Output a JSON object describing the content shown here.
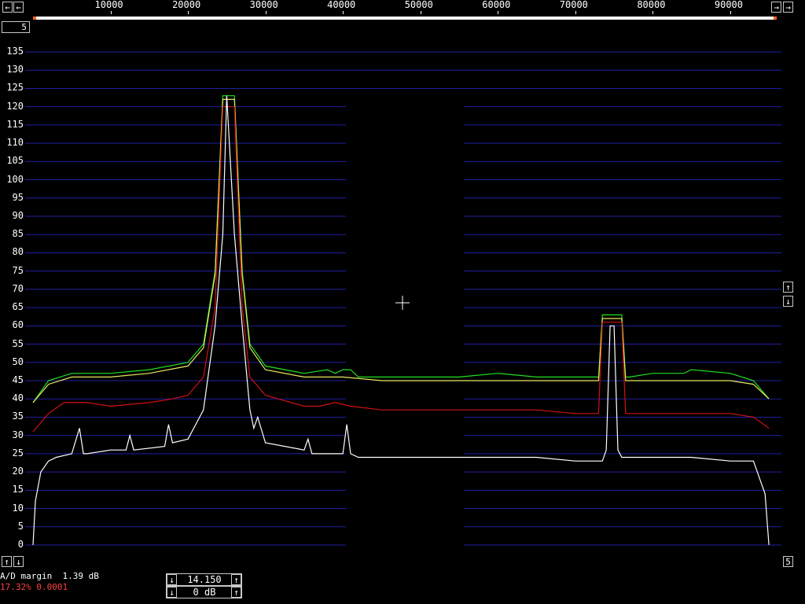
{
  "top_axis": {
    "labels": [
      "10000",
      "20000",
      "30000",
      "40000",
      "50000",
      "60000",
      "70000",
      "80000",
      "90000"
    ],
    "left_scroll_icon": "left-arrow",
    "right_scroll_icon": "right-arrow"
  },
  "corner_label": "5",
  "y_axis": {
    "ticks": [
      "135",
      "130",
      "125",
      "120",
      "115",
      "110",
      "105",
      "100",
      "95",
      "90",
      "85",
      "80",
      "75",
      "70",
      "65",
      "60",
      "55",
      "50",
      "45",
      "40",
      "35",
      "30",
      "25",
      "20",
      "15",
      "10",
      "5",
      "0"
    ]
  },
  "right_controls": {
    "up_icon": "up-arrow",
    "down_icon": "down-arrow",
    "bottom_label": "5"
  },
  "bottom_left_controls": {
    "up_icon": "up-arrow",
    "down_icon": "down-arrow"
  },
  "status": {
    "ad_margin": "A/D margin  1.39 dB",
    "percent_line": "17.32% 0.0001"
  },
  "spin_box_1": {
    "value": "14.150"
  },
  "spin_box_2": {
    "value": "0 dB"
  },
  "colors": {
    "background": "#000000",
    "grid": "#2020a0",
    "trace_green": "#20e020",
    "trace_yellow": "#e8e860",
    "trace_red": "#d01010",
    "trace_white": "#ffffff",
    "status_red": "#ff4040"
  },
  "chart_data": {
    "type": "line",
    "xlim": [
      0,
      96000
    ],
    "ylim": [
      0,
      135
    ],
    "grid": true,
    "series": [
      {
        "color": "green",
        "x": [
          0,
          2000,
          5000,
          10000,
          15000,
          20000,
          22000,
          23500,
          24500,
          25000,
          26000,
          27000,
          28000,
          30000,
          35000,
          38000,
          39000,
          40000,
          41000,
          42000,
          45000,
          50000,
          55000,
          60000,
          65000,
          70000,
          73000,
          73500,
          74000,
          75000,
          76000,
          76500,
          77000,
          80000,
          84000,
          85000,
          90000,
          93000,
          95000
        ],
        "y": [
          39,
          45,
          47,
          47,
          48,
          50,
          55,
          75,
          123,
          123,
          123,
          75,
          55,
          49,
          47,
          48,
          47,
          48,
          48,
          46,
          46,
          46,
          46,
          47,
          46,
          46,
          46,
          63,
          63,
          63,
          63,
          46,
          46,
          47,
          47,
          48,
          47,
          45,
          40
        ]
      },
      {
        "color": "yellow",
        "x": [
          0,
          2000,
          5000,
          10000,
          15000,
          20000,
          22000,
          23500,
          24500,
          25000,
          26000,
          27000,
          28000,
          30000,
          35000,
          40000,
          45000,
          50000,
          55000,
          60000,
          65000,
          70000,
          73000,
          73500,
          74000,
          75000,
          76000,
          76500,
          77000,
          80000,
          85000,
          90000,
          93000,
          95000
        ],
        "y": [
          39,
          44,
          46,
          46,
          47,
          49,
          54,
          74,
          122,
          122,
          122,
          74,
          54,
          48,
          46,
          46,
          45,
          45,
          45,
          45,
          45,
          45,
          45,
          62,
          62,
          62,
          62,
          45,
          45,
          45,
          45,
          45,
          44,
          40
        ]
      },
      {
        "color": "red",
        "x": [
          0,
          2000,
          4000,
          7000,
          10000,
          15000,
          18000,
          20000,
          22000,
          23500,
          24500,
          25000,
          26000,
          27000,
          28000,
          30000,
          35000,
          37000,
          39000,
          41000,
          45000,
          50000,
          55000,
          60000,
          65000,
          70000,
          73000,
          73500,
          74000,
          75000,
          76000,
          76500,
          77000,
          80000,
          85000,
          90000,
          93000,
          95000
        ],
        "y": [
          31,
          36,
          39,
          39,
          38,
          39,
          40,
          41,
          46,
          65,
          120,
          120,
          120,
          65,
          46,
          41,
          38,
          38,
          39,
          38,
          37,
          37,
          37,
          37,
          37,
          36,
          36,
          61,
          61,
          61,
          61,
          36,
          36,
          36,
          36,
          36,
          35,
          32
        ]
      },
      {
        "color": "white",
        "x": [
          0,
          300,
          1000,
          2000,
          3000,
          5000,
          6000,
          6500,
          7000,
          10000,
          12000,
          12500,
          13000,
          17000,
          17500,
          18000,
          20000,
          22000,
          23500,
          24500,
          25000,
          26000,
          27000,
          28000,
          28500,
          29000,
          30000,
          35000,
          35500,
          36000,
          40000,
          40500,
          41000,
          42000,
          45000,
          50000,
          55000,
          60000,
          65000,
          70000,
          73500,
          74000,
          74500,
          75000,
          75500,
          76000,
          77000,
          80000,
          85000,
          90000,
          93000,
          94500,
          95000
        ],
        "y": [
          0,
          12,
          20,
          23,
          24,
          25,
          32,
          25,
          25,
          26,
          26,
          30,
          26,
          27,
          33,
          28,
          29,
          37,
          60,
          85,
          123,
          85,
          60,
          37,
          32,
          35,
          28,
          26,
          29,
          25,
          25,
          33,
          25,
          24,
          24,
          24,
          24,
          24,
          24,
          23,
          23,
          26,
          60,
          60,
          26,
          24,
          24,
          24,
          24,
          23,
          23,
          14,
          0
        ]
      }
    ]
  }
}
